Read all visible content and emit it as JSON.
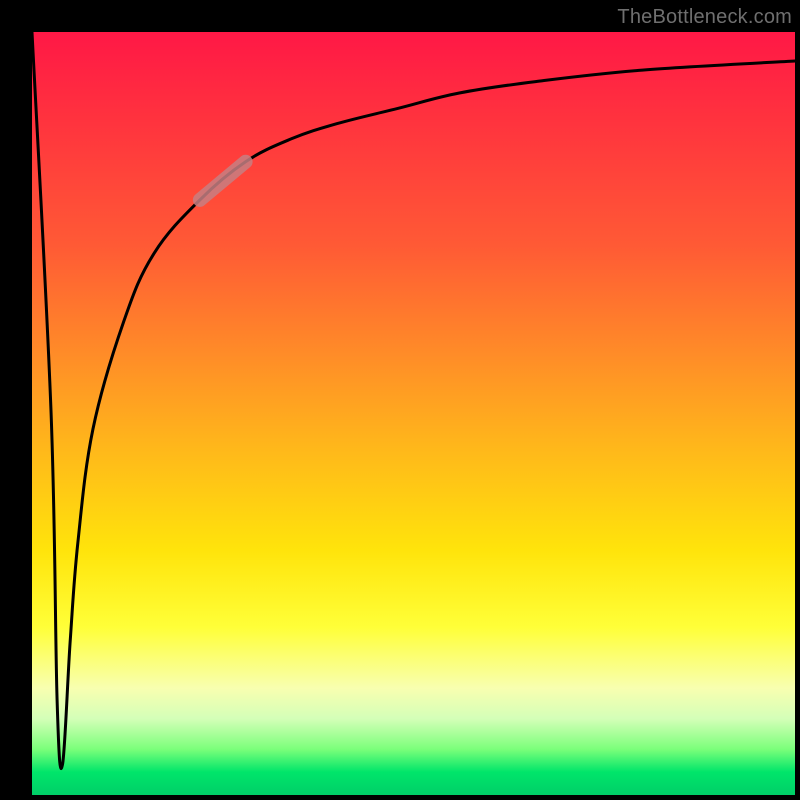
{
  "watermark": "TheBottleneck.com",
  "chart_data": {
    "type": "line",
    "title": "",
    "xlabel": "",
    "ylabel": "",
    "xlim": [
      0,
      100
    ],
    "ylim": [
      0,
      100
    ],
    "grid": false,
    "series": [
      {
        "name": "curve",
        "x": [
          0,
          2.5,
          3.3,
          4.0,
          5.0,
          6.0,
          8.0,
          12.0,
          16.0,
          22.0,
          28.0,
          34.0,
          40.0,
          48.0,
          56.0,
          66.0,
          80.0,
          100.0
        ],
        "values": [
          100,
          50,
          12,
          4,
          20,
          33,
          48,
          62,
          71,
          78,
          83,
          86,
          88,
          90,
          92,
          93.5,
          95,
          96.2
        ]
      }
    ],
    "marker_band": {
      "x_from": 22,
      "x_to": 28,
      "y_from": 78,
      "y_to": 83,
      "color": "#c77f83"
    },
    "gradient_stops": [
      {
        "pos": 0.0,
        "color": "#ff1846"
      },
      {
        "pos": 0.28,
        "color": "#ff5a35"
      },
      {
        "pos": 0.55,
        "color": "#ffb91a"
      },
      {
        "pos": 0.78,
        "color": "#ffff38"
      },
      {
        "pos": 0.9,
        "color": "#d4ffb8"
      },
      {
        "pos": 1.0,
        "color": "#00cf68"
      }
    ]
  }
}
